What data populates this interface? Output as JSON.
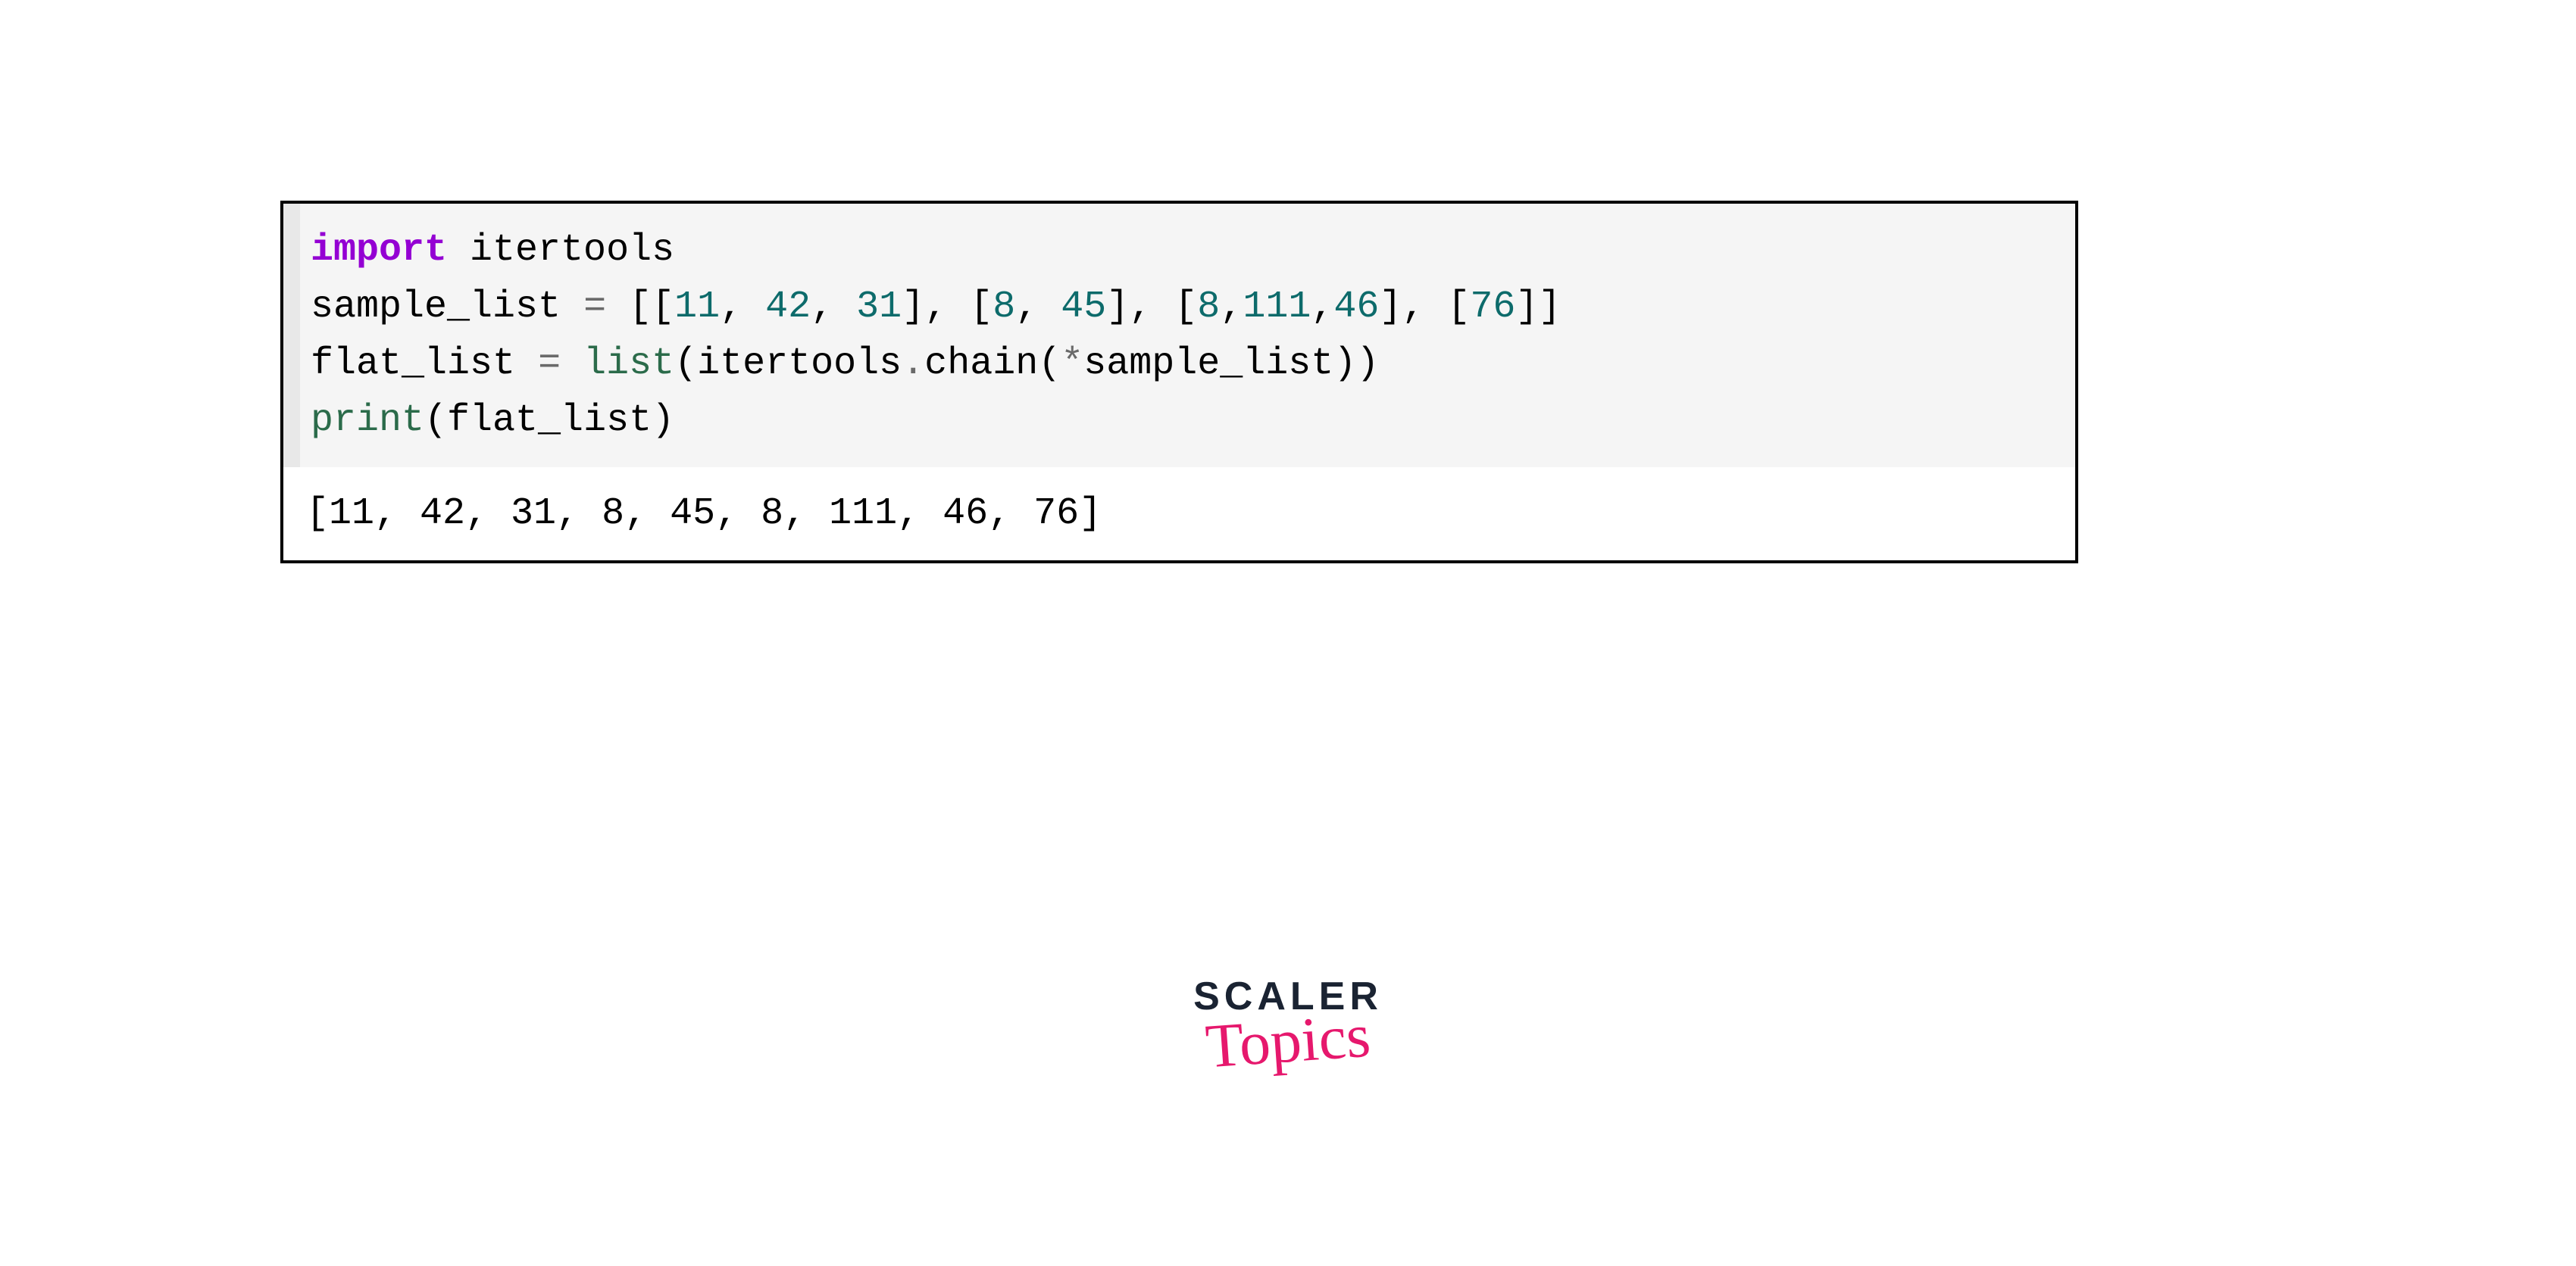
{
  "code": {
    "line1": {
      "import_kw": "import",
      "module": " itertools"
    },
    "line2": {
      "var": "sample_list ",
      "eq": "=",
      "sp": " ",
      "lb1": "[[",
      "n1": "11",
      "c1": ", ",
      "n2": "42",
      "c2": ", ",
      "n3": "31",
      "rb1": "], [",
      "n4": "8",
      "c3": ", ",
      "n5": "45",
      "rb2": "], [",
      "n6": "8",
      "c4": ",",
      "n7": "111",
      "c5": ",",
      "n8": "46",
      "rb3": "], [",
      "n9": "76",
      "rb4": "]]"
    },
    "line3": {
      "var": "flat_list ",
      "eq": "=",
      "sp": " ",
      "list_fn": "list",
      "lp": "(itertools",
      "dot": ".",
      "chain": "chain(",
      "star": "*",
      "arg": "sample_list))"
    },
    "line4": {
      "print_fn": "print",
      "lp": "(flat_list)"
    }
  },
  "output": "[11, 42, 31, 8, 45, 8, 111, 46, 76]",
  "brand": {
    "scaler": "SCALER",
    "topics": "Topics"
  }
}
